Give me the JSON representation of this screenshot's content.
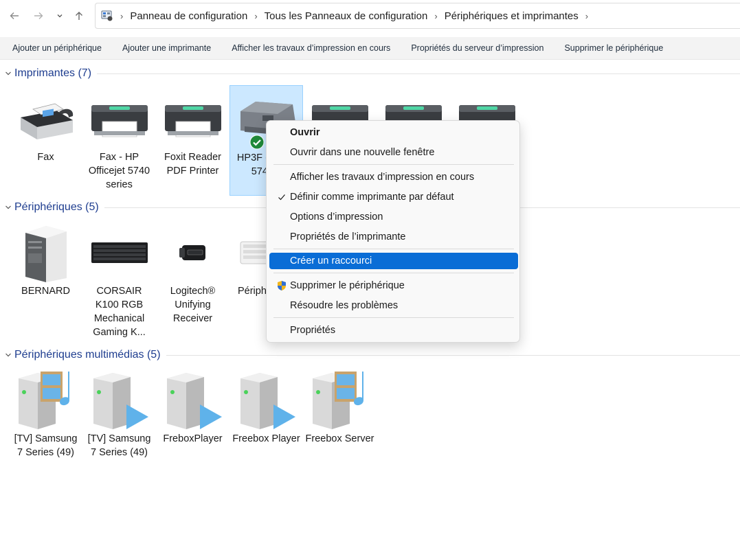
{
  "address_bar": {
    "breadcrumbs": [
      "Panneau de configuration",
      "Tous les Panneaux de configuration",
      "Périphériques et imprimantes"
    ]
  },
  "toolbar": {
    "add_device": "Ajouter un périphérique",
    "add_printer": "Ajouter une imprimante",
    "see_print_jobs": "Afficher les travaux d’impression en cours",
    "print_server_props": "Propriétés du serveur d’impression",
    "remove_device": "Supprimer le périphérique"
  },
  "groups": {
    "printers": {
      "title": "Imprimantes (7)"
    },
    "devices": {
      "title": "Périphériques (5)"
    },
    "multimedia": {
      "title": "Périphériques multimédias (5)"
    }
  },
  "printers": [
    {
      "label": "Fax",
      "icon": "fax-machine-icon"
    },
    {
      "label": "Fax - HP Officejet 5740 series",
      "icon": "printer-icon"
    },
    {
      "label": "Foxit Reader PDF Printer",
      "icon": "printer-icon"
    },
    {
      "label": "HP3F (HP Of 5740 s",
      "icon": "hp-printer-icon",
      "selected": true,
      "default": true
    },
    {
      "label": "",
      "icon": "printer-icon"
    },
    {
      "label": "",
      "icon": "printer-icon"
    },
    {
      "label": "",
      "icon": "printer-icon"
    }
  ],
  "devices": [
    {
      "label": "BERNARD",
      "icon": "computer-tower-icon"
    },
    {
      "label": "CORSAIR K100 RGB Mechanical Gaming K...",
      "icon": "keyboard-icon"
    },
    {
      "label": "Logitech® Unifying Receiver",
      "icon": "usb-receiver-icon"
    },
    {
      "label": "Périph clavie",
      "icon": "keyboard-white-icon"
    }
  ],
  "multimedia": [
    {
      "label": "[TV] Samsung 7 Series (49)",
      "icon": "media-server-icon"
    },
    {
      "label": "[TV] Samsung 7 Series (49)",
      "icon": "media-player-icon"
    },
    {
      "label": "FreboxPlayer",
      "icon": "media-player-icon"
    },
    {
      "label": "Freebox Player",
      "icon": "media-player-icon"
    },
    {
      "label": "Freebox Server",
      "icon": "media-server-icon"
    }
  ],
  "context_menu": {
    "open": "Ouvrir",
    "open_new_window": "Ouvrir dans une nouvelle fenêtre",
    "see_jobs": "Afficher les travaux d’impression en cours",
    "set_default": "Définir comme imprimante par défaut",
    "print_options": "Options d’impression",
    "printer_props": "Propriétés de l’imprimante",
    "create_shortcut": "Créer un raccourci",
    "remove_device": "Supprimer le périphérique",
    "troubleshoot": "Résoudre les problèmes",
    "properties": "Propriétés"
  },
  "colors": {
    "accent": "#0a6dd6",
    "group_title": "#1e3d8f",
    "selection_bg": "#cce8ff",
    "default_check": "#1f8a3a"
  }
}
